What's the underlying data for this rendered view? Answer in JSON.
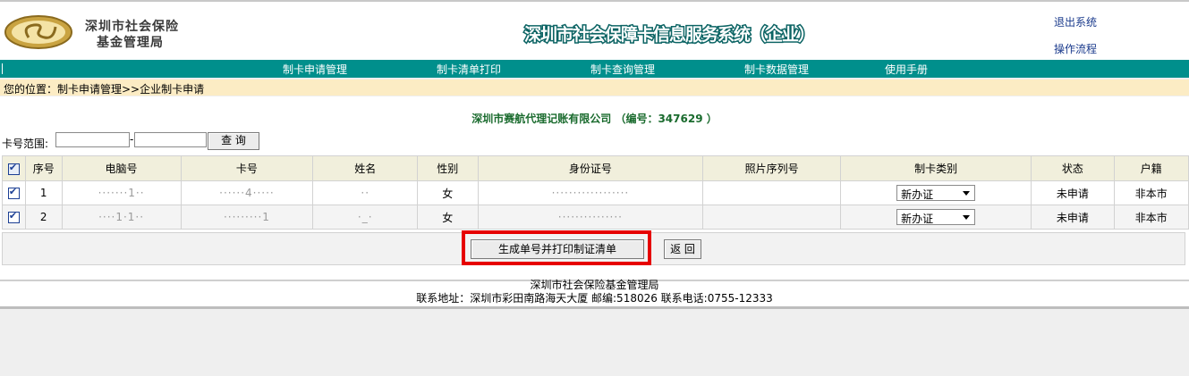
{
  "header": {
    "org_line1": "深圳市社会保险",
    "org_line2": "基金管理局",
    "system_title": "深圳市社会保障卡信息服务系统（企业）",
    "logout": "退出系统",
    "process": "操作流程"
  },
  "nav": {
    "items": [
      {
        "label": "制卡申请管理"
      },
      {
        "label": "制卡清单打印"
      },
      {
        "label": "制卡查询管理"
      },
      {
        "label": "制卡数据管理"
      },
      {
        "label": "使用手册"
      }
    ]
  },
  "breadcrumb": "您的位置：制卡申请管理>>企业制卡申请",
  "company": "深圳市赛航代理记账有限公司 （编号：347629 ）",
  "search": {
    "label": "卡号范围:",
    "from": "",
    "dash": "-",
    "to": "",
    "button": "查 询"
  },
  "table": {
    "headers": [
      "序号",
      "电脑号",
      "卡号",
      "姓名",
      "性别",
      "身份证号",
      "照片序列号",
      "制卡类别",
      "状态",
      "户籍"
    ],
    "rows": [
      {
        "seq": "1",
        "computer_no": "·······1··",
        "card_no": "······4·····",
        "name": "··",
        "gender": "女",
        "id_no": "··················",
        "photo_no": "",
        "card_type": "新办证",
        "status": "未申请",
        "huji": "非本市"
      },
      {
        "seq": "2",
        "computer_no": "····1·1··",
        "card_no": "·········1",
        "name": "·_·",
        "gender": "女",
        "id_no": "···············",
        "photo_no": "",
        "card_type": "新办证",
        "status": "未申请",
        "huji": "非本市"
      }
    ]
  },
  "actions": {
    "generate": "生成单号并打印制证清单",
    "back": "返 回"
  },
  "footer": {
    "line1": "深圳市社会保险基金管理局",
    "line2": "联系地址：深圳市彩田南路海天大厦  邮编:518026 联系电话:0755-12333"
  },
  "colors": {
    "nav": "#008f8c",
    "breadcrumb_bg": "#fcecc4",
    "company_text": "#1a6b2e",
    "highlight": "#e60000"
  }
}
